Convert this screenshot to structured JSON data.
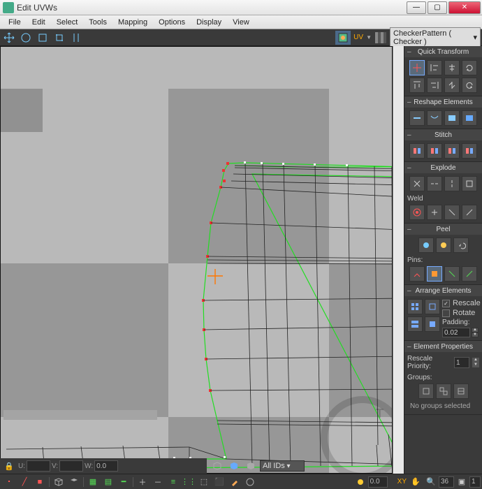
{
  "window": {
    "title": "Edit UVWs"
  },
  "menus": [
    "File",
    "Edit",
    "Select",
    "Tools",
    "Mapping",
    "Options",
    "Display",
    "View"
  ],
  "toolbar": {
    "uv_label": "UV",
    "texture_dd": "CheckerPattern  ( Checker )"
  },
  "sidebar": {
    "quick_transform": {
      "title": "Quick Transform"
    },
    "reshape": {
      "title": "Reshape Elements"
    },
    "stitch": {
      "title": "Stitch"
    },
    "explode": {
      "title": "Explode",
      "weld_label": "Weld"
    },
    "peel": {
      "title": "Peel",
      "pins_label": "Pins:"
    },
    "arrange": {
      "title": "Arrange Elements",
      "rescale": "Rescale",
      "rotate": "Rotate",
      "padding_label": "Padding:",
      "padding_value": "0.02"
    },
    "props": {
      "title": "Element Properties",
      "prio_label": "Rescale Priority:",
      "prio_value": "1",
      "groups_label": "Groups:",
      "empty": "No groups selected"
    }
  },
  "status": {
    "u_label": "U:",
    "u_value": "",
    "v_label": "V:",
    "v_value": "",
    "w_label": "W:",
    "w_value": "0.0",
    "ids_dd": "All IDs",
    "xy_label": "XY",
    "pct_value": "36",
    "layer_value": "1"
  }
}
